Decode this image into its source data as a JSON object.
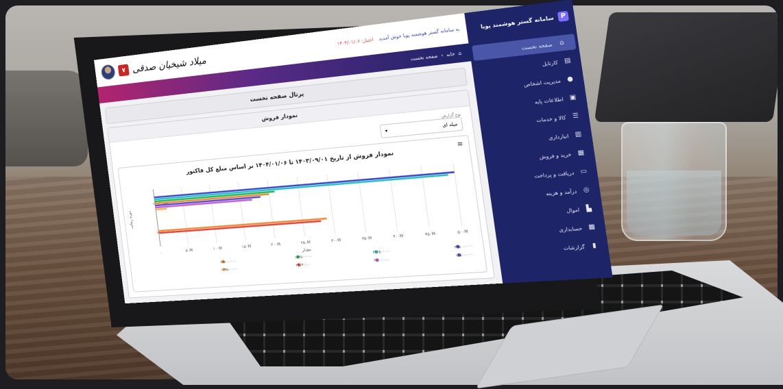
{
  "app": {
    "brand_name": "سامانه گستر هوشمند پویا",
    "welcome_text": "به سامانه گستر هوشمند پویا خوش آمدید",
    "expire_text": "اعتبار: ۱۴۰۴/۰۱/۰۶",
    "user_signature": "میلاد شیخیان صدقی",
    "notification_count": "۷"
  },
  "breadcrumb": {
    "home": "خانه",
    "current": "صفحه نخست"
  },
  "sidebar": {
    "items": [
      {
        "label": "صفحه نخست",
        "icon": "home-icon",
        "active": true
      },
      {
        "label": "کارتابل",
        "icon": "inbox-icon"
      },
      {
        "label": "مدیریت اشخاص",
        "icon": "user-icon"
      },
      {
        "label": "اطلاعات پایه",
        "icon": "lock-icon"
      },
      {
        "label": "کالا و خدمات",
        "icon": "grid-icon"
      },
      {
        "label": "انبارداری",
        "icon": "warehouse-icon"
      },
      {
        "label": "خرید و فروش",
        "icon": "cart-icon"
      },
      {
        "label": "دریافت و پرداخت",
        "icon": "card-icon"
      },
      {
        "label": "درآمد و هزینه",
        "icon": "coin-icon"
      },
      {
        "label": "اموال",
        "icon": "building-icon"
      },
      {
        "label": "حسابداری",
        "icon": "calculator-icon"
      },
      {
        "label": "گزارشات",
        "icon": "chart-icon"
      }
    ]
  },
  "main": {
    "page_title": "پرتال صفحه نخست",
    "card_title": "نمودار فروش",
    "select_label": "نوع گزارش",
    "select_value": "میله ای"
  },
  "chart_data": {
    "type": "bar",
    "orientation": "horizontal",
    "title": "نمودار فروش از تاریخ ۱۴۰۳/۰۹/۰۱ تا ۱۴۰۴/۰۱/۰۶ بر اساس مبلغ کل فاکتور",
    "ylabel": "دوره زمانی",
    "xlabel": "مقدار",
    "categories": [
      "بهمن ۱۴۰۳",
      "اسفند ۱۴۰۳"
    ],
    "x_ticks": [
      "۰",
      "۵۰M",
      "۱۰۰M",
      "۱۵۰M",
      "۲۰۰M",
      "۲۵۰M",
      "۳۰۰M",
      "۳۵۰M",
      "۴۰۰M",
      "۴۵۰M",
      "۵۰۰M"
    ],
    "xlim": [
      0,
      500000000
    ],
    "series": [
      {
        "name": "۲۴۵۰۰۰۰۰۰",
        "color": "#3a49c8",
        "values": [
          500000000,
          0
        ]
      },
      {
        "name": "۲۱۴۵۰۰۰۰۰",
        "color": "#2ac0c6",
        "values": [
          490000000,
          0
        ]
      },
      {
        "name": "۱۶۴۵۰۰۰۰۰",
        "color": "#24b65a",
        "values": [
          210000000,
          0
        ]
      },
      {
        "name": "۱۹۵۰۰۰۰۰۰",
        "color": "#f08a3a",
        "values": [
          200000000,
          290000000
        ]
      },
      {
        "name": "۱۴۵۰۰۰۰۰۰",
        "color": "#5a4fc8",
        "values": [
          185000000,
          0
        ]
      },
      {
        "name": "۲۵۰۰۰۰۰۰",
        "color": "#c25fd9",
        "values": [
          170000000,
          0
        ]
      },
      {
        "name": "۲۴۱۳۰۰۰۰",
        "color": "#e4473f",
        "values": [
          0,
          280000000
        ]
      },
      {
        "name": "۱۶۹۵۰۰۰۰۰",
        "color": "#f7b14a",
        "values": [
          20000000,
          0
        ]
      }
    ],
    "legend_position": "bottom",
    "grid": true
  }
}
